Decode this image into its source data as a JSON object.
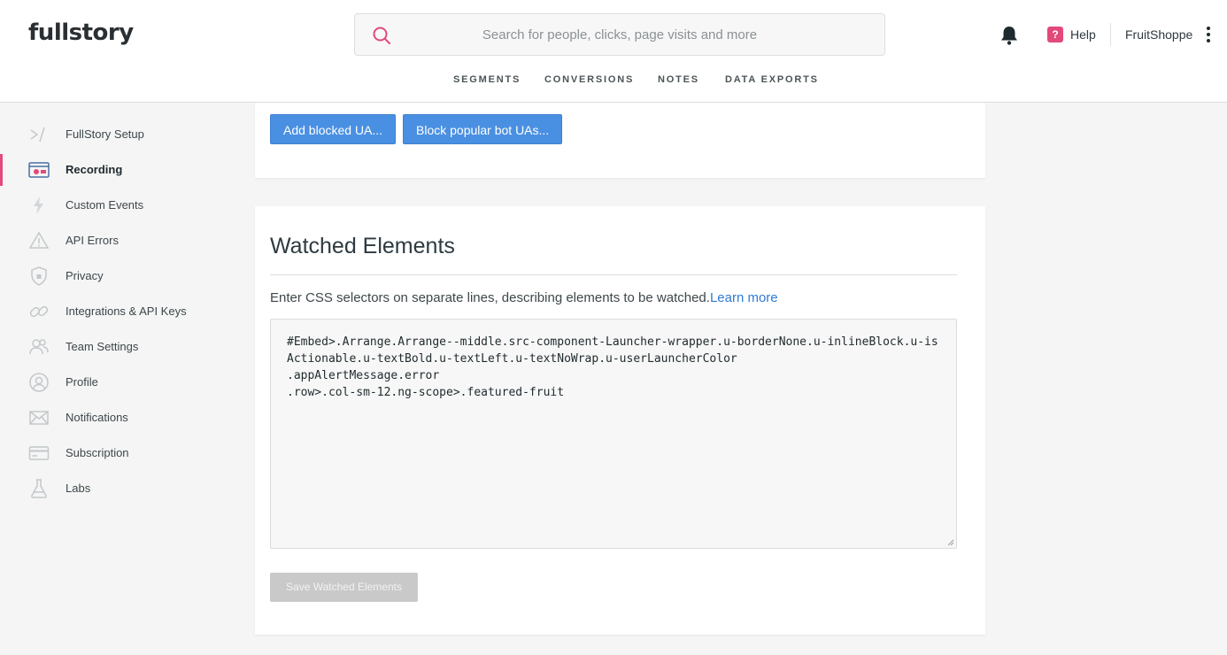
{
  "header": {
    "logo_text": "fullstory",
    "search_placeholder": "Search for people, clicks, page visits and more",
    "help_label": "Help",
    "help_badge": "?",
    "org_name": "FruitShoppe",
    "accent_color": "#e3497a",
    "nav": [
      "SEGMENTS",
      "CONVERSIONS",
      "NOTES",
      "DATA EXPORTS"
    ]
  },
  "sidebar": {
    "items": [
      {
        "label": "FullStory Setup",
        "icon": "code-icon"
      },
      {
        "label": "Recording",
        "icon": "recording-icon",
        "active": true
      },
      {
        "label": "Custom Events",
        "icon": "bolt-icon"
      },
      {
        "label": "API Errors",
        "icon": "warning-icon"
      },
      {
        "label": "Privacy",
        "icon": "shield-icon"
      },
      {
        "label": "Integrations & API Keys",
        "icon": "link-icon"
      },
      {
        "label": "Team Settings",
        "icon": "team-icon"
      },
      {
        "label": "Profile",
        "icon": "user-icon"
      },
      {
        "label": "Notifications",
        "icon": "mail-icon"
      },
      {
        "label": "Subscription",
        "icon": "card-icon"
      },
      {
        "label": "Labs",
        "icon": "flask-icon"
      }
    ]
  },
  "blocked_ua": {
    "add_button": "Add blocked UA...",
    "block_bots_button": "Block popular bot UAs..."
  },
  "watched": {
    "title": "Watched Elements",
    "description": "Enter CSS selectors on separate lines, describing elements to be watched.",
    "learn_more": "Learn more",
    "selectors": [
      "#Embed>.Arrange.Arrange--middle.src-component-Launcher-wrapper.u-borderNone.u-inlineBlock.u-isActionable.u-textBold.u-textLeft.u-textNoWrap.u-userLauncherColor",
      ".appAlertMessage.error",
      ".row>.col-sm-12.ng-scope>.featured-fruit"
    ],
    "save_button": "Save Watched Elements"
  }
}
